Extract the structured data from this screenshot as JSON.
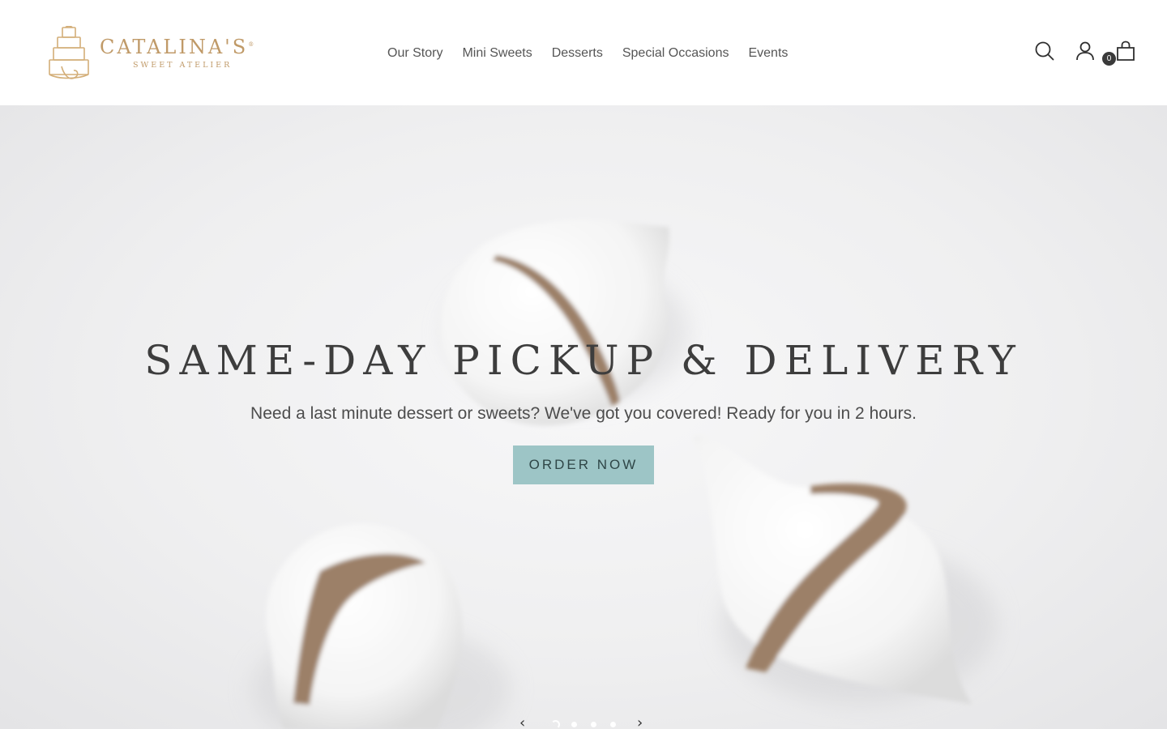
{
  "brand": {
    "name": "CATALINA'S",
    "registered": "®",
    "tagline": "SWEET ATELIER",
    "color": "#c09a68"
  },
  "nav": {
    "items": [
      {
        "label": "Our Story"
      },
      {
        "label": "Mini Sweets"
      },
      {
        "label": "Desserts"
      },
      {
        "label": "Special Occasions"
      },
      {
        "label": "Events"
      }
    ]
  },
  "header_icons": {
    "search": "search-icon",
    "account": "user-icon",
    "cart": "shopping-bag-icon",
    "cart_count": "0"
  },
  "hero": {
    "title": "SAME-DAY PICKUP & DELIVERY",
    "text": "Need a last minute dessert or sweets? We've got you covered! Ready for you in 2 hours.",
    "button_label": "ORDER NOW",
    "button_color": "#9dc5c6",
    "slider": {
      "prev": "‹",
      "next": "›",
      "slide_count": 4,
      "active_slide": 1
    }
  }
}
